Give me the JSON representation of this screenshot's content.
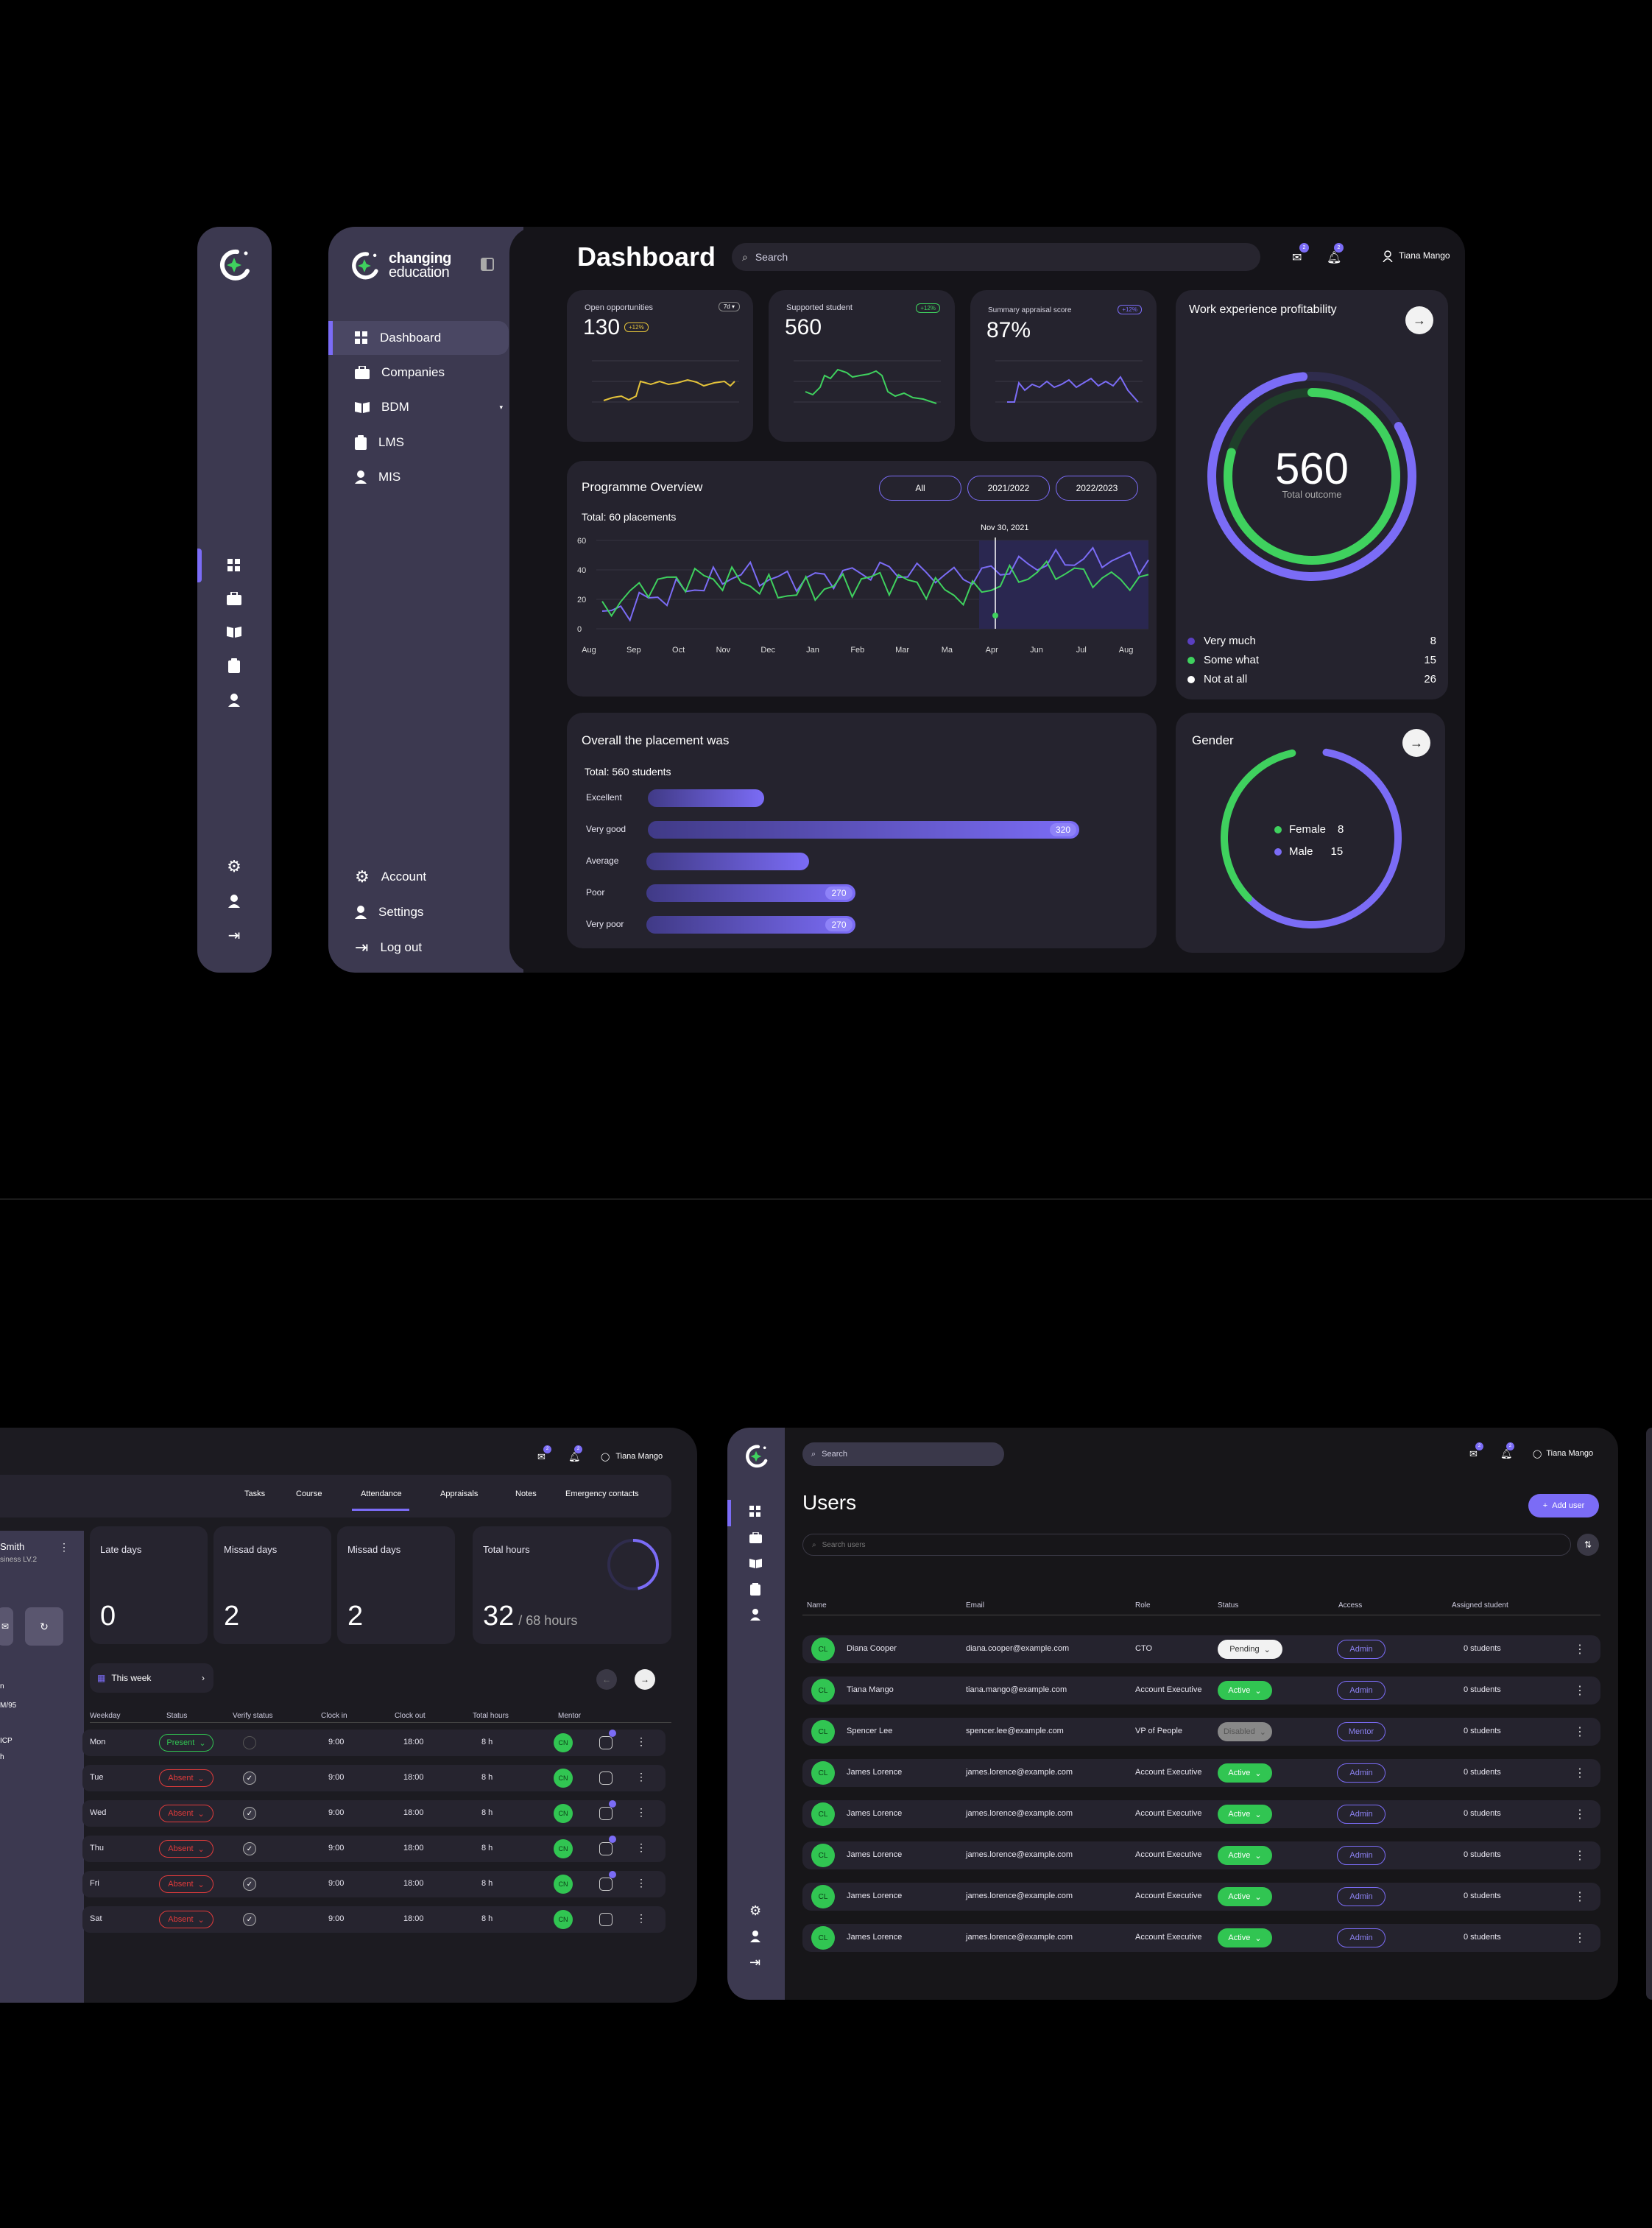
{
  "brand": {
    "line1": "changing",
    "line2": "education"
  },
  "sidebar": {
    "items": [
      {
        "label": "Dashboard",
        "icon": "grid-icon"
      },
      {
        "label": "Companies",
        "icon": "briefcase-icon"
      },
      {
        "label": "BDM",
        "icon": "book-icon"
      },
      {
        "label": "LMS",
        "icon": "clipboard-icon"
      },
      {
        "label": "MIS",
        "icon": "user-icon"
      }
    ],
    "bottom": [
      {
        "label": "Account",
        "icon": "gear-icon"
      },
      {
        "label": "Settings",
        "icon": "user-icon"
      },
      {
        "label": "Log out",
        "icon": "logout-icon"
      }
    ]
  },
  "header": {
    "title": "Dashboard",
    "search_placeholder": "Search",
    "mail_count": "2",
    "bell_count": "2",
    "user": "Tiana Mango"
  },
  "kpis": [
    {
      "label": "Open opportunities",
      "value": "130",
      "badge": "+12%",
      "tag": "7d",
      "color": "#e3c23a"
    },
    {
      "label": "Supported student",
      "value": "560",
      "badge": "+12%",
      "color": "#3fd15e"
    },
    {
      "label": "Summary appraisal score",
      "value": "87%",
      "badge": "+12%",
      "color": "#7b6cf6"
    }
  ],
  "programme": {
    "title": "Programme Overview",
    "subtitle": "Total: 60 placements",
    "filters": [
      "All",
      "2021/2022",
      "2022/2023"
    ],
    "marker_label": "Nov 30, 2021",
    "y_ticks": [
      "60",
      "40",
      "20",
      "0"
    ],
    "x_ticks": [
      "Aug",
      "Sep",
      "Oct",
      "Nov",
      "Dec",
      "Jan",
      "Feb",
      "Mar",
      "Ma",
      "Apr",
      "Jun",
      "Jul",
      "Aug"
    ]
  },
  "chart_data": [
    {
      "type": "line",
      "title": "Programme Overview",
      "subtitle": "Total: 60 placements",
      "x": [
        "Aug",
        "Sep",
        "Oct",
        "Nov",
        "Dec",
        "Jan",
        "Feb",
        "Mar",
        "Ma",
        "Apr",
        "Jun",
        "Jul",
        "Aug"
      ],
      "ylim": [
        0,
        60
      ],
      "series": [
        {
          "color": "#7b6cf6",
          "values": [
            8,
            20,
            28,
            38,
            33,
            35,
            40,
            38,
            35,
            42,
            46,
            48,
            45
          ]
        },
        {
          "color": "#3fd15e",
          "values": [
            12,
            30,
            35,
            33,
            24,
            28,
            34,
            30,
            22,
            35,
            40,
            34,
            32
          ]
        }
      ]
    },
    {
      "type": "bar",
      "title": "Overall the placement was",
      "subtitle": "Total: 560 students",
      "categories": [
        "Excellent",
        "Very good",
        "Average",
        "Poor",
        "Very poor"
      ],
      "values": [
        150,
        320,
        210,
        270,
        270
      ],
      "labels": [
        "",
        "320",
        "",
        "270",
        "270"
      ]
    },
    {
      "type": "pie",
      "title": "Work experience profitability",
      "center_value": "560",
      "center_label": "Total outcome",
      "categories": [
        "Very much",
        "Some what",
        "Not at all"
      ],
      "values": [
        8,
        15,
        26
      ],
      "colors": [
        "#5a3fc0",
        "#3fd15e",
        "#ffffff"
      ]
    },
    {
      "type": "pie",
      "title": "Gender",
      "categories": [
        "Female",
        "Male"
      ],
      "values": [
        8,
        15
      ],
      "colors": [
        "#3fd15e",
        "#7b6cf6"
      ]
    }
  ],
  "attendance": {
    "user": "Tiana Mango",
    "mail_count": "2",
    "bell_count": "2",
    "tabs": [
      "Tasks",
      "Course",
      "Attendance",
      "Appraisals",
      "Notes",
      "Emergency contacts"
    ],
    "profile_name": "Smith",
    "profile_sub": "siness LV.2",
    "side_labels": [
      "n",
      "M/95",
      "ICP",
      "h"
    ],
    "stats": [
      {
        "label": "Late days",
        "value": "0"
      },
      {
        "label": "Missad days",
        "value": "2"
      },
      {
        "label": "Missad days",
        "value": "2"
      },
      {
        "label": "Total hours",
        "value": "32",
        "suffix": "/ 68 hours"
      }
    ],
    "week": "This week",
    "headers": [
      "Weekday",
      "Status",
      "Verify status",
      "Clock in",
      "Clock out",
      "Total hours",
      "Mentor"
    ],
    "rows": [
      {
        "day": "Mon",
        "status": "Present",
        "in": "9:00",
        "out": "18:00",
        "total": "8 h",
        "mentor": "CN"
      },
      {
        "day": "Tue",
        "status": "Absent",
        "in": "9:00",
        "out": "18:00",
        "total": "8 h",
        "mentor": "CN"
      },
      {
        "day": "Wed",
        "status": "Absent",
        "in": "9:00",
        "out": "18:00",
        "total": "8 h",
        "mentor": "CN"
      },
      {
        "day": "Thu",
        "status": "Absent",
        "in": "9:00",
        "out": "18:00",
        "total": "8 h",
        "mentor": "CN"
      },
      {
        "day": "Fri",
        "status": "Absent",
        "in": "9:00",
        "out": "18:00",
        "total": "8 h",
        "mentor": "CN"
      },
      {
        "day": "Sat",
        "status": "Absent",
        "in": "9:00",
        "out": "18:00",
        "total": "8 h",
        "mentor": "CN"
      }
    ]
  },
  "users": {
    "search_placeholder": "Search",
    "user": "Tiana Mango",
    "mail_count": "2",
    "bell_count": "2",
    "title": "Users",
    "add_label": "Add user",
    "filter_placeholder": "Search users",
    "headers": [
      "Name",
      "Email",
      "Role",
      "Status",
      "Access",
      "Assigned student"
    ],
    "rows": [
      {
        "initials": "CL",
        "name": "Diana Cooper",
        "email": "diana.cooper@example.com",
        "role": "CTO",
        "status": "Pending",
        "access": "Admin",
        "assigned": "0 students"
      },
      {
        "initials": "CL",
        "name": "Tiana Mango",
        "email": "tiana.mango@example.com",
        "role": "Account Executive",
        "status": "Active",
        "access": "Admin",
        "assigned": "0 students"
      },
      {
        "initials": "CL",
        "name": "Spencer Lee",
        "email": "spencer.lee@example.com",
        "role": "VP of People",
        "status": "Disabled",
        "access": "Mentor",
        "assigned": "0 students"
      },
      {
        "initials": "CL",
        "name": "James Lorence",
        "email": "james.lorence@example.com",
        "role": "Account Executive",
        "status": "Active",
        "access": "Admin",
        "assigned": "0 students"
      },
      {
        "initials": "CL",
        "name": "James Lorence",
        "email": "james.lorence@example.com",
        "role": "Account Executive",
        "status": "Active",
        "access": "Admin",
        "assigned": "0 students"
      },
      {
        "initials": "CL",
        "name": "James Lorence",
        "email": "james.lorence@example.com",
        "role": "Account Executive",
        "status": "Active",
        "access": "Admin",
        "assigned": "0 students"
      },
      {
        "initials": "CL",
        "name": "James Lorence",
        "email": "james.lorence@example.com",
        "role": "Account Executive",
        "status": "Active",
        "access": "Admin",
        "assigned": "0 students"
      },
      {
        "initials": "CL",
        "name": "James Lorence",
        "email": "james.lorence@example.com",
        "role": "Account Executive",
        "status": "Active",
        "access": "Admin",
        "assigned": "0 students"
      }
    ]
  }
}
